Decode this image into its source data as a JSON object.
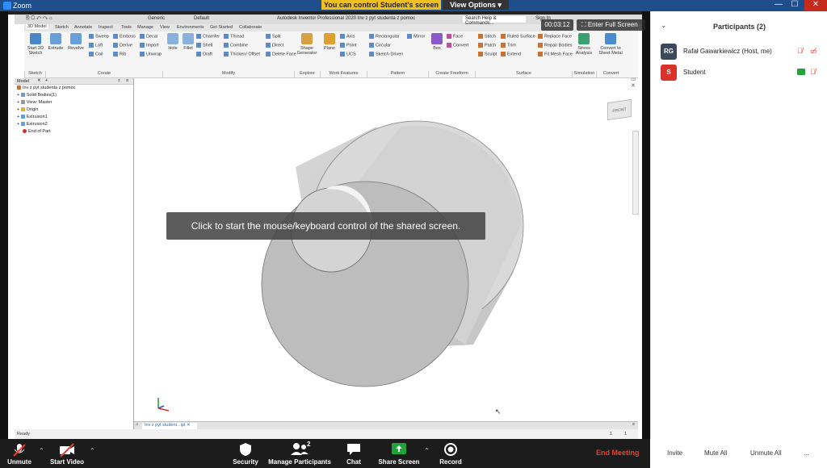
{
  "zoom": {
    "app_title": "Zoom",
    "control_banner": "You can control Student's screen",
    "view_options": "View Options",
    "timer": "00:03:12",
    "fullscreen_label": "Enter Full Screen",
    "toast": "Click to start the mouse/keyboard control of the shared screen."
  },
  "inventor": {
    "title": "Autodesk Inventor Professional 2020   Inv z pyt studenta z pomoc",
    "material": "Generic",
    "appearance": "Default",
    "search_placeholder": "Search Help & Commands...",
    "sign_in": "Sign In",
    "tabs": [
      "3D Model",
      "Sketch",
      "Annotate",
      "Inspect",
      "Tools",
      "Manage",
      "View",
      "Environments",
      "Get Started",
      "Collaborate"
    ],
    "ribbon": {
      "start_sketch": "Start 2D Sketch",
      "extrude": "Extrude",
      "revolve": "Revolve",
      "sweep": "Sweep",
      "emboss": "Emboss",
      "decal": "Decal",
      "loft": "Loft",
      "derive": "Derive",
      "import": "Import",
      "coil": "Coil",
      "rib": "Rib",
      "unwrap": "Unwrap",
      "hole": "Hole",
      "fillet": "Fillet",
      "chamfer": "Chamfer",
      "thread": "Thread",
      "split": "Split",
      "shell": "Shell",
      "combine": "Combine",
      "direct": "Direct",
      "draft": "Draft",
      "thicken": "Thicken/ Offset",
      "delete_face": "Delete Face",
      "shape_generator": "Shape Generator",
      "plane": "Plane",
      "axis": "Axis",
      "point": "Point",
      "ucs": "UCS",
      "rectangular": "Rectangular",
      "mirror": "Mirror",
      "circular": "Circular",
      "sketch_driven": "Sketch Driven",
      "box": "Box",
      "face": "Face",
      "convert": "Convert",
      "stitch": "Stitch",
      "ruled_surface": "Ruled Surface",
      "replace_face": "Replace Face",
      "patch": "Patch",
      "trim": "Trim",
      "repair_bodies": "Repair Bodies",
      "sculpt": "Sculpt",
      "extend": "Extend",
      "fit_mesh_face": "Fit Mesh Face",
      "stress_analysis": "Stress Analysis",
      "convert_sheet_metal": "Convert to Sheet Metal"
    },
    "groups": [
      "Sketch",
      "Create",
      "Modify",
      "Explore",
      "Work Features",
      "Pattern",
      "Create Freeform",
      "Surface",
      "Simulation",
      "Convert"
    ],
    "browser": {
      "tab": "Model",
      "items": [
        "Inv z pyt studenta z pomoc",
        "Solid Bodies(1)",
        "View: Master",
        "Origin",
        "Extrusion1",
        "Extrusion2",
        "End of Part"
      ]
    },
    "viewcube_label": "FRONT",
    "doc_tab": "Inv z pyt student...ipt",
    "status_left": "Ready",
    "status_right_1": "1",
    "status_right_2": "1"
  },
  "participants": {
    "title": "Participants (2)",
    "list": [
      {
        "initials": "RG",
        "name": "Rafał Gawarkiewicz (Host, me)",
        "color": "#3a4a5c"
      },
      {
        "initials": "S",
        "name": "Student",
        "color": "#d9322b"
      }
    ],
    "invite": "Invite",
    "mute_all": "Mute All",
    "unmute_all": "Unmute All",
    "more": "..."
  },
  "toolbar": {
    "unmute": "Unmute",
    "start_video": "Start Video",
    "security": "Security",
    "manage_participants": "Manage Participants",
    "participant_count": "2",
    "chat": "Chat",
    "share_screen": "Share Screen",
    "record": "Record",
    "end_meeting": "End Meeting"
  },
  "colors": {
    "zoom_blue": "#1e4e8c",
    "banner_yellow": "#f0c020",
    "end_meeting_red": "#e8412e",
    "share_green": "#20a33a"
  }
}
